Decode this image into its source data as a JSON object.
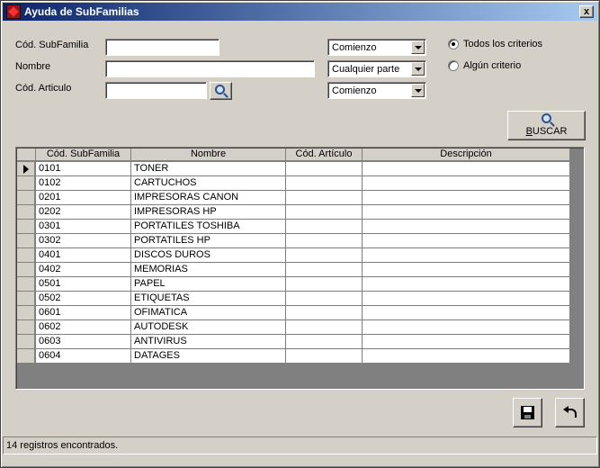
{
  "window": {
    "title": "Ayuda de SubFamilias",
    "close_glyph": "x"
  },
  "form": {
    "cod_subfamilia_label": "Cód. SubFamilia",
    "cod_subfamilia_value": "",
    "cod_subfamilia_mode": "Comienzo",
    "nombre_label": "Nombre",
    "nombre_value": "",
    "nombre_mode": "Cualquier parte",
    "cod_articulo_label": "Cód. Articulo",
    "cod_articulo_value": "",
    "cod_articulo_mode": "Comienzo"
  },
  "criteria": {
    "todos_label": "Todos los criterios",
    "algun_label": "Algún criterio",
    "selected": "todos"
  },
  "buscar_button": {
    "label": "BUSCAR",
    "icon": "magnifier-icon"
  },
  "grid": {
    "columns": [
      "Cód. SubFamilia",
      "Nombre",
      "Cód. Artículo",
      "Descripción"
    ],
    "rows": [
      {
        "cod": "0101",
        "nombre": "TONER",
        "articulo": "",
        "descripcion": ""
      },
      {
        "cod": "0102",
        "nombre": "CARTUCHOS",
        "articulo": "",
        "descripcion": ""
      },
      {
        "cod": "0201",
        "nombre": "IMPRESORAS CANON",
        "articulo": "",
        "descripcion": ""
      },
      {
        "cod": "0202",
        "nombre": "IMPRESORAS HP",
        "articulo": "",
        "descripcion": ""
      },
      {
        "cod": "0301",
        "nombre": "PORTATILES TOSHIBA",
        "articulo": "",
        "descripcion": ""
      },
      {
        "cod": "0302",
        "nombre": "PORTATILES HP",
        "articulo": "",
        "descripcion": ""
      },
      {
        "cod": "0401",
        "nombre": "DISCOS DUROS",
        "articulo": "",
        "descripcion": ""
      },
      {
        "cod": "0402",
        "nombre": "MEMORIAS",
        "articulo": "",
        "descripcion": ""
      },
      {
        "cod": "0501",
        "nombre": "PAPEL",
        "articulo": "",
        "descripcion": ""
      },
      {
        "cod": "0502",
        "nombre": "ETIQUETAS",
        "articulo": "",
        "descripcion": ""
      },
      {
        "cod": "0601",
        "nombre": "OFIMATICA",
        "articulo": "",
        "descripcion": ""
      },
      {
        "cod": "0602",
        "nombre": "AUTODESK",
        "articulo": "",
        "descripcion": ""
      },
      {
        "cod": "0603",
        "nombre": "ANTIVIRUS",
        "articulo": "",
        "descripcion": ""
      },
      {
        "cod": "0604",
        "nombre": "DATAGES",
        "articulo": "",
        "descripcion": ""
      }
    ],
    "current_row": 0
  },
  "toolbar": {
    "save_icon": "floppy-disk-icon",
    "undo_icon": "undo-icon"
  },
  "status": {
    "text": "14 registros encontrados."
  }
}
